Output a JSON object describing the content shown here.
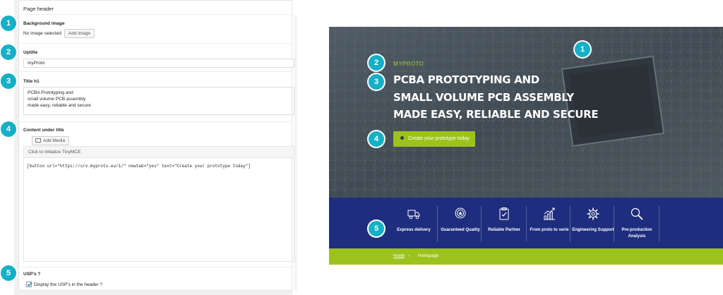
{
  "admin": {
    "header_title": "Page header",
    "background_image": {
      "label": "Background image",
      "status": "No image selected",
      "add_button": "Add image"
    },
    "uptitle": {
      "label": "Uptitle",
      "value": "myProto"
    },
    "title_h1": {
      "label": "Title h1",
      "lines": [
        "PCBA Prototyping and",
        "small volume PCB assembly",
        "made easy, reliable and secure"
      ]
    },
    "content": {
      "label": "Content under title",
      "add_media": "Add Media",
      "tinymce_hint": "Click to initialize TinyMCE",
      "shortcode": "[button url=\"https://srv.myproto.eu/1/\" newtab=\"yes\" text=\"Create your prototype today\"]"
    },
    "usps": {
      "label": "USP's ?",
      "checkbox_label": "Display the USP's in the header ?",
      "checked": true
    }
  },
  "badges": [
    "1",
    "2",
    "3",
    "4",
    "5"
  ],
  "preview": {
    "uptitle": "MYPROTO",
    "title_lines": [
      "PCBA PROTOTYPING AND",
      "SMALL VOLUME PCB ASSEMBLY",
      "MADE EASY, RELIABLE AND SECURE"
    ],
    "cta_label": "Create your prototype today",
    "usps": [
      {
        "label": "Express delivery",
        "icon": "truck-icon"
      },
      {
        "label": "Guaranteed Quality",
        "icon": "quality-medal-icon"
      },
      {
        "label": "Reliable Partner",
        "icon": "clipboard-check-icon"
      },
      {
        "label": "From proto to serie",
        "icon": "growth-chart-icon"
      },
      {
        "label": "Engineering Support",
        "icon": "gear-icon"
      },
      {
        "label": "Pre-production Analysis",
        "icon": "magnifier-icon"
      }
    ],
    "breadcrumb": {
      "home": "Home",
      "separator": "›",
      "current": "Homepage"
    }
  },
  "colors": {
    "badge": "#14b0c7",
    "accent_green": "#9bc31c",
    "usp_band": "#1f2d7e",
    "hero_overlay": "#4e5861"
  }
}
